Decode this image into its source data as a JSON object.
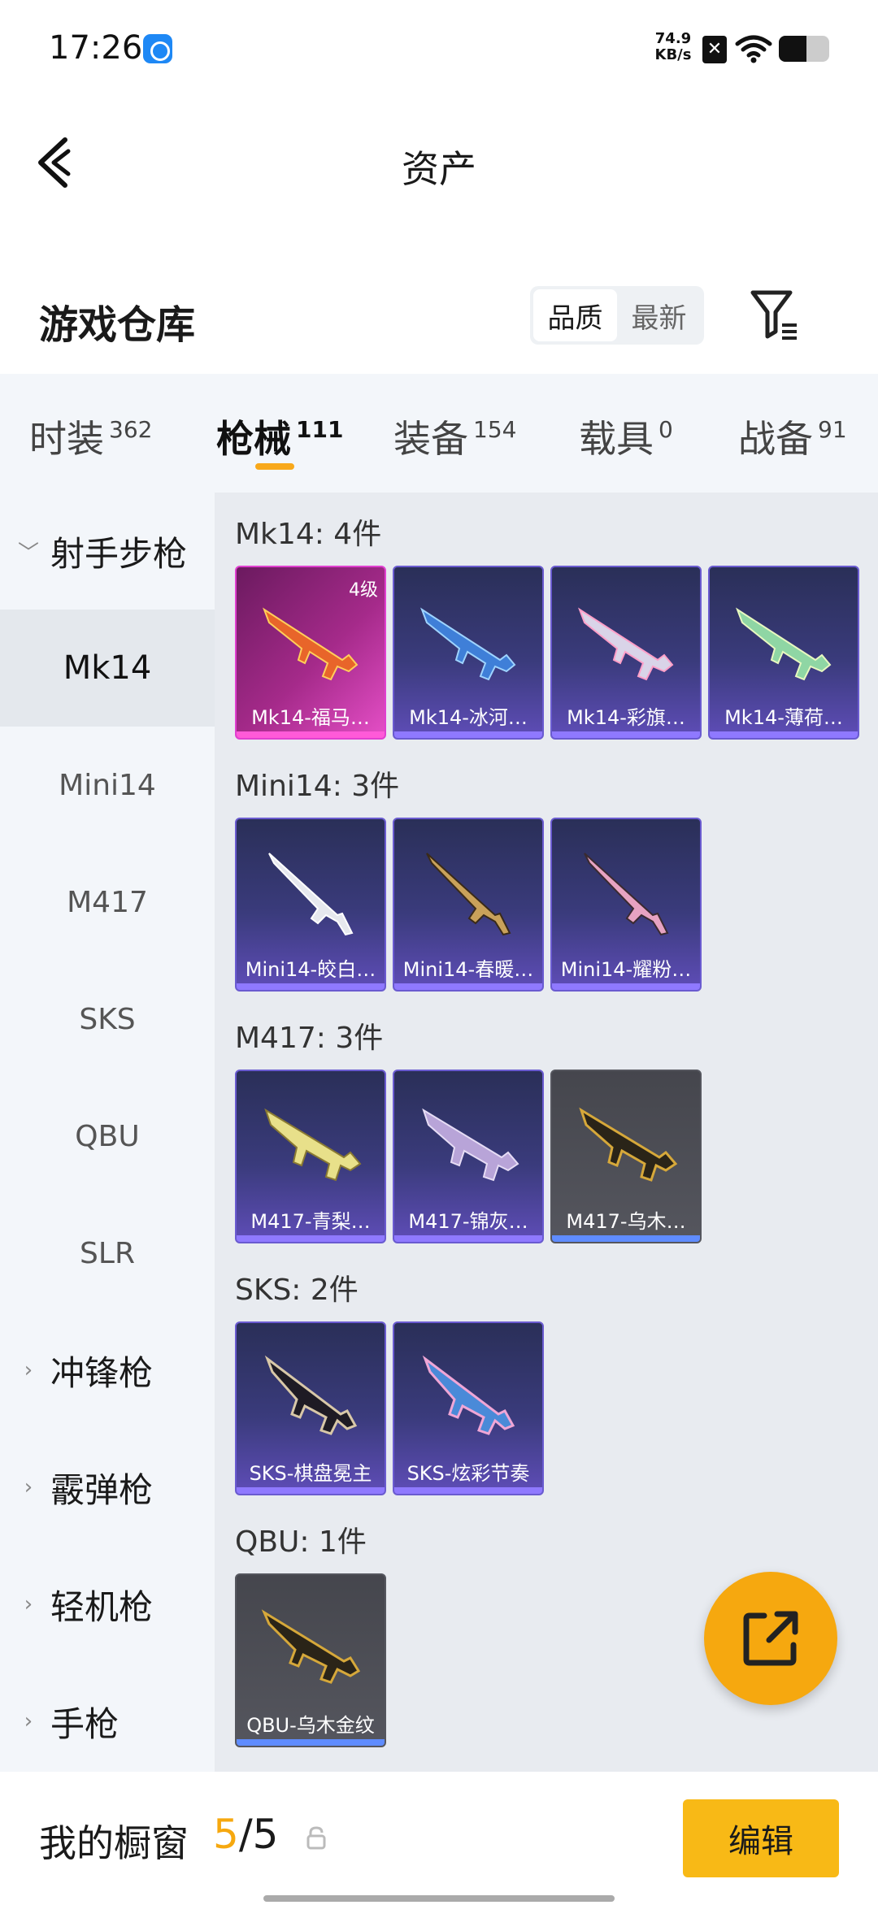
{
  "status_bar": {
    "time": "17:26",
    "speed_value": "74.9",
    "speed_unit": "KB/s",
    "battery_level": 0.55
  },
  "header": {
    "title": "资产"
  },
  "warehouse": {
    "title": "游戏仓库",
    "sort_options": [
      "品质",
      "最新"
    ],
    "active_sort": "品质"
  },
  "tabs": [
    {
      "label": "时装",
      "count": "362"
    },
    {
      "label": "枪械",
      "count": "111"
    },
    {
      "label": "装备",
      "count": "154"
    },
    {
      "label": "载具",
      "count": "0"
    },
    {
      "label": "战备",
      "count": "91"
    }
  ],
  "active_tab": "枪械",
  "sidebar": {
    "group_expanded": "射手步枪",
    "items": [
      "Mk14",
      "Mini14",
      "M417",
      "SKS",
      "QBU",
      "SLR"
    ],
    "active_item": "Mk14",
    "collapsed_groups": [
      "冲锋枪",
      "霰弹枪",
      "轻机枪",
      "手枪"
    ]
  },
  "sections": [
    {
      "title": "Mk14: 4件",
      "cards": [
        {
          "name": "Mk14-福马…",
          "level": "4级",
          "tier": "legend",
          "icon": "rifle-icon"
        },
        {
          "name": "Mk14-冰河…",
          "tier": "epic",
          "icon": "rifle-icon"
        },
        {
          "name": "Mk14-彩旗…",
          "tier": "epic",
          "icon": "rifle-icon"
        },
        {
          "name": "Mk14-薄荷…",
          "tier": "epic",
          "icon": "rifle-icon"
        }
      ]
    },
    {
      "title": "Mini14: 3件",
      "cards": [
        {
          "name": "Mini14-皎白…",
          "tier": "epic",
          "icon": "rifle-icon"
        },
        {
          "name": "Mini14-春暖…",
          "tier": "epic",
          "icon": "rifle-icon"
        },
        {
          "name": "Mini14-耀粉…",
          "tier": "epic",
          "icon": "rifle-icon"
        }
      ]
    },
    {
      "title": "M417: 3件",
      "cards": [
        {
          "name": "M417-青梨…",
          "tier": "epic",
          "icon": "rifle-icon"
        },
        {
          "name": "M417-锦灰…",
          "tier": "epic",
          "icon": "rifle-icon"
        },
        {
          "name": "M417-乌木…",
          "tier": "rare",
          "icon": "rifle-icon"
        }
      ]
    },
    {
      "title": "SKS: 2件",
      "cards": [
        {
          "name": "SKS-棋盘冕主",
          "tier": "epic",
          "icon": "rifle-icon"
        },
        {
          "name": "SKS-炫彩节奏",
          "tier": "epic",
          "icon": "rifle-icon"
        }
      ]
    },
    {
      "title": "QBU: 1件",
      "cards": [
        {
          "name": "QBU-乌木金纹",
          "tier": "rare",
          "icon": "rifle-icon"
        }
      ]
    }
  ],
  "bottom": {
    "label": "我的橱窗",
    "current": "5",
    "separator": "/",
    "max": "5",
    "edit_label": "编辑"
  },
  "colors": {
    "accent": "#f6a80f",
    "legend": "#e040d0",
    "epic": "#6a5bd0",
    "rare": "#55565e"
  }
}
